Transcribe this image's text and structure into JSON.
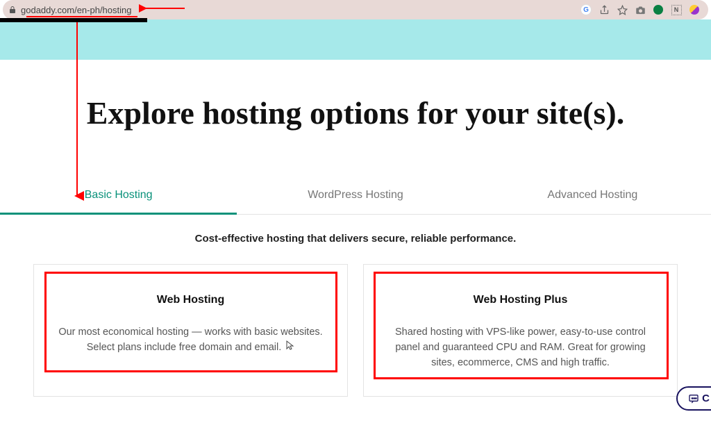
{
  "browser": {
    "url": "godaddy.com/en-ph/hosting"
  },
  "page": {
    "headline": "Explore hosting options for your site(s).",
    "tabs": [
      {
        "label": "Basic Hosting",
        "active": true
      },
      {
        "label": "WordPress Hosting",
        "active": false
      },
      {
        "label": "Advanced Hosting",
        "active": false
      }
    ],
    "subhead": "Cost-effective hosting that delivers secure, reliable performance.",
    "cards": [
      {
        "title": "Web Hosting",
        "desc": "Our most economical hosting — works with basic websites. Select plans include free domain and email."
      },
      {
        "title": "Web Hosting Plus",
        "desc": "Shared hosting with VPS-like power, easy-to-use control panel and guaranteed CPU and RAM. Great for growing sites, ecommerce, CMS and high traffic."
      }
    ]
  },
  "icons": {
    "g": "G",
    "n": "N"
  }
}
